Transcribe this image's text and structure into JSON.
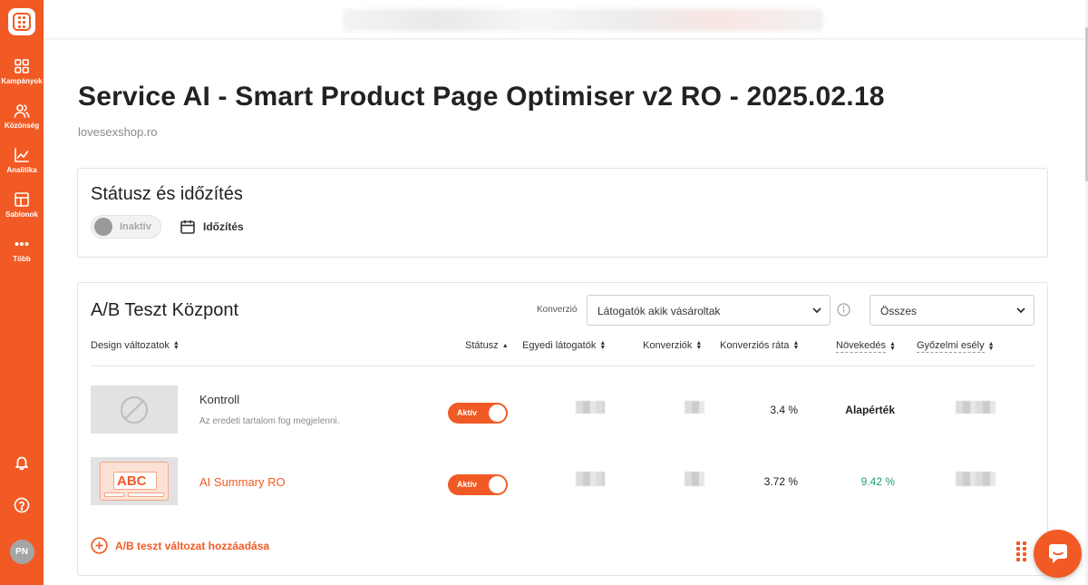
{
  "sidebar": {
    "nav": [
      {
        "label": "Kampányok",
        "icon": "grid-icon"
      },
      {
        "label": "Közönség",
        "icon": "users-icon"
      },
      {
        "label": "Analitika",
        "icon": "chart-line-icon"
      },
      {
        "label": "Sablonok",
        "icon": "template-icon"
      },
      {
        "label": "Több",
        "icon": "more-icon"
      }
    ],
    "avatar": "PN"
  },
  "page": {
    "title": "Service AI - Smart Product Page Optimiser v2 RO - 2025.02.18",
    "domain": "lovesexshop.ro"
  },
  "status_card": {
    "title": "Státusz és időzítés",
    "toggle_label": "Inaktív",
    "schedule_label": "Időzítés"
  },
  "ab_card": {
    "title": "A/B Teszt Központ",
    "conversion_label": "Konverzió",
    "conversion_select": "Látogatók akik vásároltak",
    "filter_select": "Összes",
    "columns": {
      "design": "Design változatok",
      "status": "Státusz",
      "visitors": "Egyedi látogatók",
      "conversions": "Konverziók",
      "rate": "Konverziós ráta",
      "uplift": "Növekedés",
      "chance": "Győzelmi esély"
    },
    "rows": [
      {
        "name": "Kontroll",
        "description": "Az eredeti tartalom fog megjelenni.",
        "status": "Aktív",
        "rate": "3.4 %",
        "uplift": "Alapérték"
      },
      {
        "name": "AI Summary RO",
        "thumb_text": "ABC",
        "status": "Aktív",
        "rate": "3.72 %",
        "uplift": "9.42 %"
      }
    ],
    "add_variant": "A/B teszt változat hozzáadása"
  },
  "colors": {
    "brand": "#f15a24",
    "positive": "#1e9e6a",
    "muted": "#8a8a8a"
  }
}
